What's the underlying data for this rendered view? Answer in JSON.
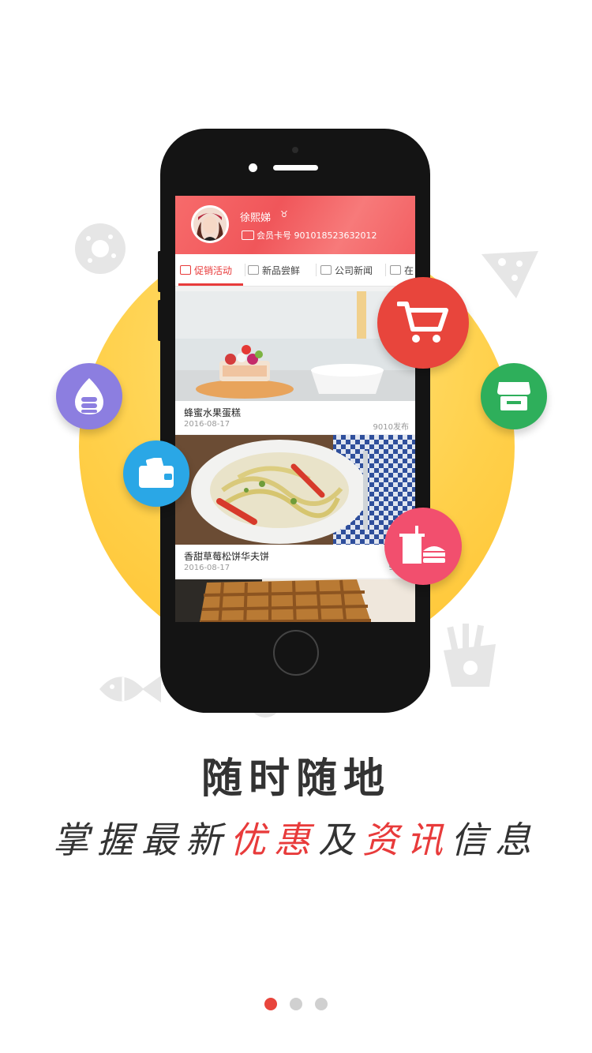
{
  "profile": {
    "name": "徐熙娣",
    "card_label": "会员卡号",
    "card_number": "901018523632012"
  },
  "tabs": [
    {
      "label": "促销活动",
      "active": true
    },
    {
      "label": "新品尝鲜",
      "active": false
    },
    {
      "label": "公司新闻",
      "active": false
    },
    {
      "label": "在",
      "active": false
    }
  ],
  "posts": [
    {
      "title": "蜂蜜水果蛋糕",
      "date": "2016-08-17",
      "publisher": "9010发布"
    },
    {
      "title": "香甜草莓松饼华夫饼",
      "date": "2016-08-17",
      "publisher": "9010"
    }
  ],
  "headline": "随时随地",
  "subtitle": {
    "p1": "掌握最新",
    "h1": "优惠",
    "p2": "及",
    "h2": "资讯",
    "p3": "信息"
  },
  "pager": {
    "total": 3,
    "current": 1
  },
  "icons": [
    "donut-icon",
    "pizza-icon",
    "coins-icon",
    "cart-icon",
    "store-icon",
    "wallet-icon",
    "fastfood-icon",
    "fries-icon",
    "fish-icon",
    "drumstick-icon"
  ],
  "colors": {
    "accent": "#e83b3b",
    "yellow": "#ffd04a",
    "purple": "#8c7ee0",
    "green": "#2eaf5b",
    "blue": "#2aa7e6",
    "pink": "#f24f6e",
    "cart_red": "#e8453c"
  }
}
